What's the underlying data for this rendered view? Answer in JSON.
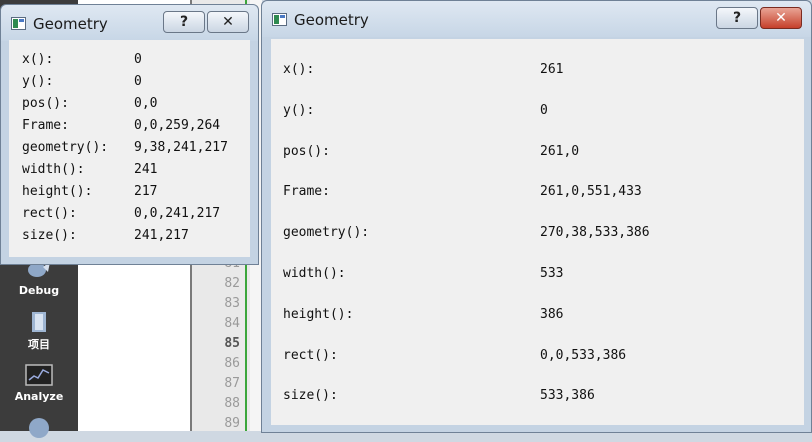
{
  "ide": {
    "tools": [
      {
        "label": "Debug",
        "icon": "bug-icon"
      },
      {
        "label": "项目",
        "icon": "project-icon"
      },
      {
        "label": "Analyze",
        "icon": "analyze-icon"
      }
    ],
    "line_numbers": [
      "81",
      "82",
      "83",
      "84",
      "85",
      "86",
      "87",
      "88",
      "89"
    ],
    "current_line": "85"
  },
  "small_window": {
    "title": "Geometry",
    "help_label": "?",
    "close_label": "✕",
    "rows": [
      {
        "key": "x():",
        "value": "0"
      },
      {
        "key": "y():",
        "value": "0"
      },
      {
        "key": "pos():",
        "value": "0,0"
      },
      {
        "key": "Frame:",
        "value": "0,0,259,264"
      },
      {
        "key": "geometry():",
        "value": "9,38,241,217"
      },
      {
        "key": "width():",
        "value": "241"
      },
      {
        "key": "height():",
        "value": "217"
      },
      {
        "key": "rect():",
        "value": "0,0,241,217"
      },
      {
        "key": "size():",
        "value": "241,217"
      }
    ]
  },
  "large_window": {
    "title": "Geometry",
    "help_label": "?",
    "close_label": "✕",
    "rows": [
      {
        "key": "x():",
        "value": "261"
      },
      {
        "key": "y():",
        "value": "0"
      },
      {
        "key": "pos():",
        "value": "261,0"
      },
      {
        "key": "Frame:",
        "value": "261,0,551,433"
      },
      {
        "key": "geometry():",
        "value": "270,38,533,386"
      },
      {
        "key": "width():",
        "value": "533"
      },
      {
        "key": "height():",
        "value": "386"
      },
      {
        "key": "rect():",
        "value": "0,0,533,386"
      },
      {
        "key": "size():",
        "value": "533,386"
      }
    ]
  }
}
